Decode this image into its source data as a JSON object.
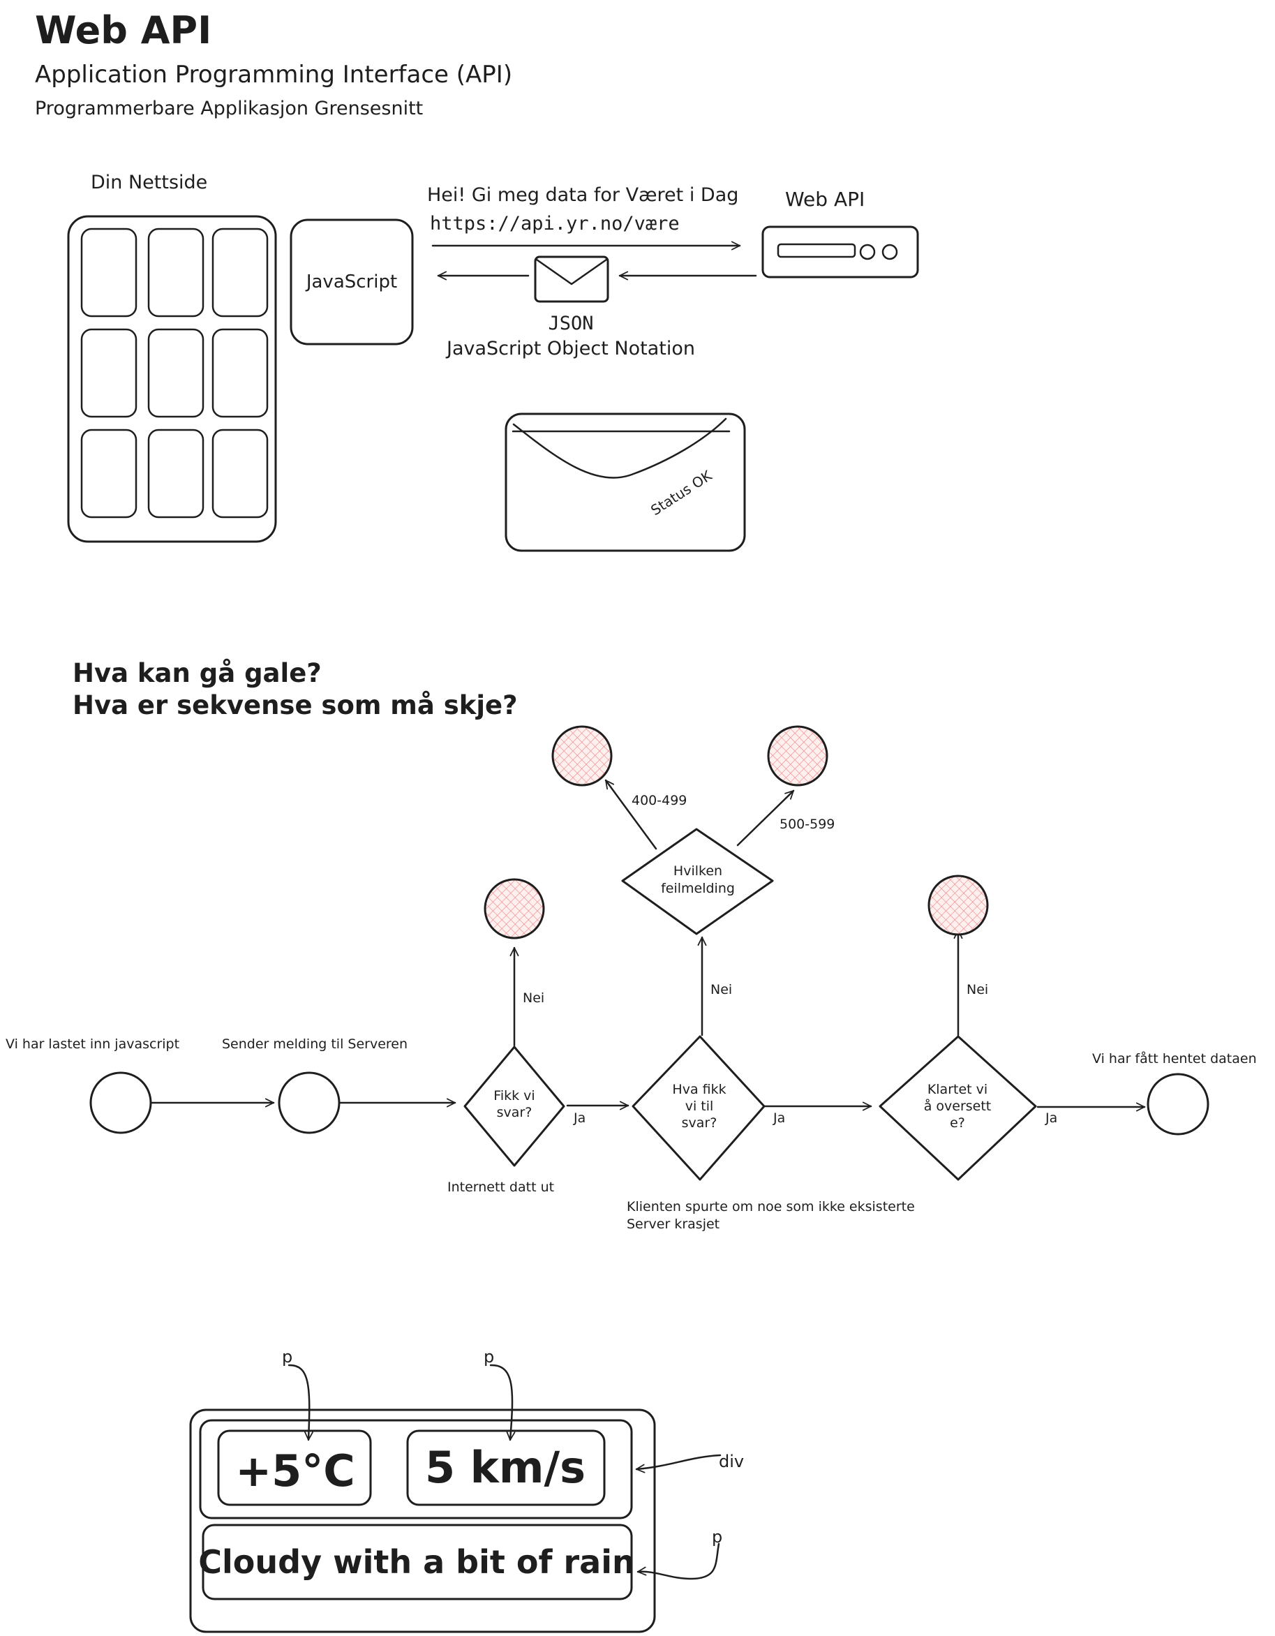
{
  "header": {
    "title": "Web API",
    "subtitle": "Application Programming Interface (API)",
    "subtitle_no": "Programmerbare Applikasjon Grensesnitt"
  },
  "request_diagram": {
    "website_label": "Din Nettside",
    "javascript_label": "JavaScript",
    "request_text": "Hei! Gi meg data for Været i Dag",
    "request_url": "https://api.yr.no/være",
    "api_label": "Web API",
    "response_title": "JSON",
    "response_subtitle": "JavaScript Object Notation",
    "envelope_stamp": "Status OK"
  },
  "questions": {
    "line1": "Hva kan gå gale?",
    "line2": "Hva er sekvense som må skje?"
  },
  "flowchart": {
    "start_label": "Vi har lastet inn javascript",
    "send_label": "Sender melding til Serveren",
    "decision1": [
      "Fikk vi",
      "svar?"
    ],
    "decision2": [
      "Hva fikk",
      "vi til",
      "svar?"
    ],
    "decision3": [
      "Klartet vi",
      "å oversett",
      "e?"
    ],
    "error_decision": [
      "Hvilken",
      "feilmelding"
    ],
    "yes": "Ja",
    "no": "Nei",
    "code_4xx": "400-499",
    "code_5xx": "500-599",
    "end_label": "Vi har fått hentet dataen",
    "note1": "Internett datt ut",
    "note2_line1": "Klienten spurte om noe som ikke eksisterte",
    "note2_line2": "Server krasjet"
  },
  "weather_widget": {
    "temperature": "+5°C",
    "wind": "5 km/s",
    "description": "Cloudy with a bit of rain",
    "p_label": "p",
    "div_label": "div"
  },
  "colors": {
    "ink": "#1e1e1e",
    "error_fill": "#ffc9c9",
    "error_hatch": "#e03131"
  }
}
